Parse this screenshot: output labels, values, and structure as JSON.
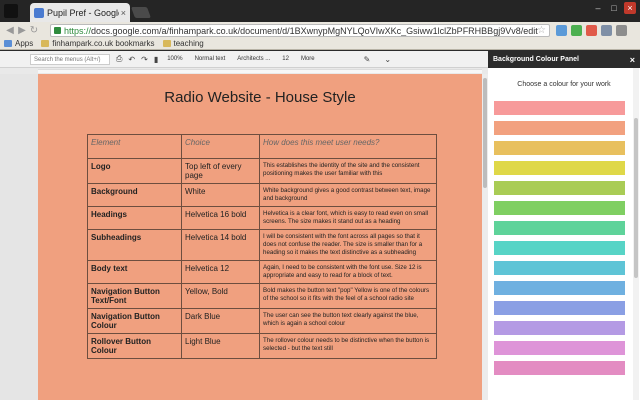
{
  "browser": {
    "tab_title": "Pupil Pref - Google D",
    "tab_close": "×",
    "url_https": "https://",
    "url_rest": "docs.google.com/a/finhampark.co.uk/document/d/1BXwnypMgNYLQoVIwXKc_Gsiww1lclZbPFRHBBgj9Vv8/edit",
    "bookmarks": [
      "Apps",
      "finhampark.co.uk bookmarks",
      "teaching"
    ]
  },
  "docs_toolbar": {
    "menu_search_placeholder": "Search the menus (Alt+/)",
    "zoom": "100%",
    "style": "Normal text",
    "font": "Architects ...",
    "size": "12",
    "more": "More"
  },
  "document": {
    "title": "Radio Website  - House Style",
    "table": {
      "headers": [
        "Element",
        "Choice",
        "How does this meet user needs?"
      ],
      "rows": [
        {
          "element": "Logo",
          "choice": "Top left of every page",
          "reason": "This establishes the identity of the site and the consistent positioning makes the user familiar with this"
        },
        {
          "element": "Background",
          "choice": "White",
          "reason": "White background gives a good contrast between text, image and background"
        },
        {
          "element": "Headings",
          "choice": "Helvetica 16 bold",
          "reason": "Helvetica is a clear font,  which is easy to read  even on small screens.  The  size makes it stand out as a heading"
        },
        {
          "element": "Subheadings",
          "choice": "Helvetica 14 bold",
          "reason": "I will be consistent with the font across all pages so that it does not confuse the reader.  The size  is smaller than for a heading so it makes the text distinctive as a subheading"
        },
        {
          "element": "Body text",
          "choice": "Helvetica 12",
          "reason": "Again, I need to be consistent with the font use.  Size 12 is appropriate  and  easy to read for a block of text."
        },
        {
          "element": "Navigation Button Text/Font",
          "choice": "Yellow, Bold",
          "reason": "Bold makes the button text \"pop\"  Yellow is one of the colours of the school so it fits with the feel of a school radio site"
        },
        {
          "element": "Navigation Button Colour",
          "choice": "Dark Blue",
          "reason": "The user can see the button text clearly against the blue, which is again a school colour"
        },
        {
          "element": "Rollover Button Colour",
          "choice": "Light Blue",
          "reason": "The rollover colour needs to be distinctive when the button is selected - but the text still"
        }
      ]
    }
  },
  "panel": {
    "title": "Background Colour Panel",
    "close": "×",
    "subtitle": "Choose a colour for your work",
    "swatch_colors": [
      "#f79a9a",
      "#f2a17f",
      "#e8c05e",
      "#dfd848",
      "#a9cc55",
      "#7fcf62",
      "#5ed39a",
      "#57d4c6",
      "#5ec4d6",
      "#6fb0e0",
      "#8a9fe4",
      "#b49ae4",
      "#de94d8",
      "#e38cc2"
    ]
  }
}
